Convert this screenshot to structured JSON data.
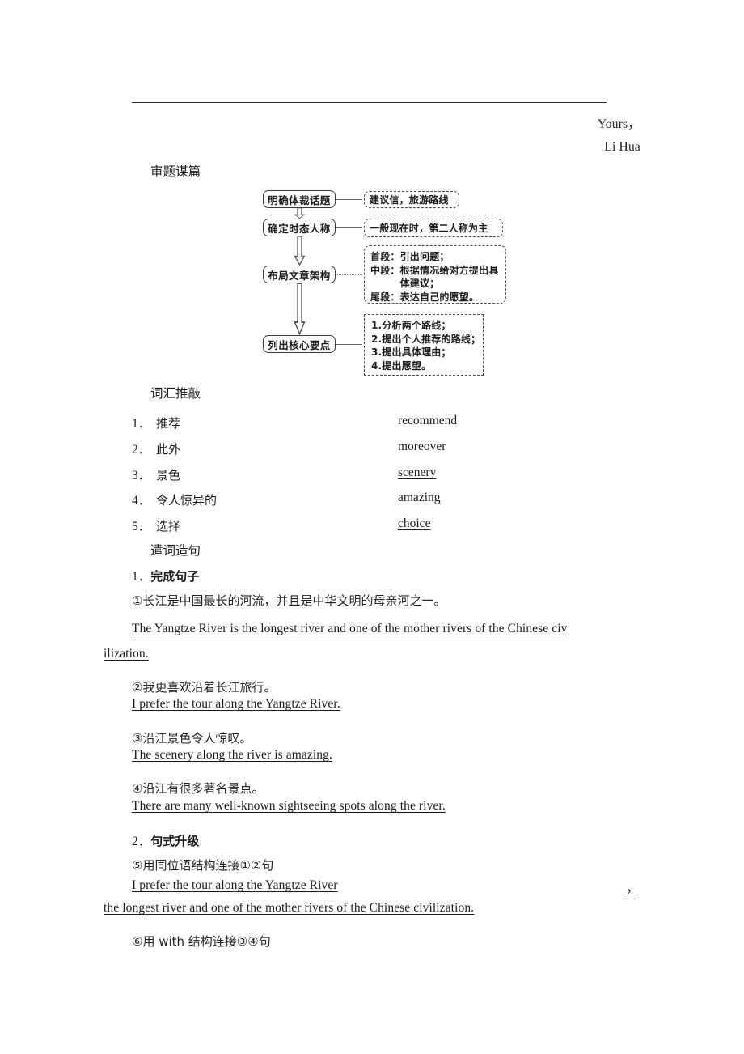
{
  "signature": {
    "closing": "Yours，",
    "name": "Li Hua"
  },
  "sections": {
    "analysis_label": "审题谋篇",
    "vocab_label": "词汇推敲",
    "sentence_label": "遣词造句"
  },
  "flowchart": {
    "nodes": [
      {
        "label": "明确体裁话题"
      },
      {
        "label": "确定时态人称"
      },
      {
        "label": "布局文章架构"
      },
      {
        "label": "列出核心要点"
      }
    ],
    "callouts": [
      {
        "lines": [
          "建议信，旅游路线"
        ]
      },
      {
        "lines": [
          "一般现在时，第二人称为主"
        ]
      },
      {
        "rows": [
          {
            "tag": "首段：",
            "body": "引出问题；"
          },
          {
            "tag": "中段：",
            "body": "根据情况给对方提出具体建议；"
          },
          {
            "tag": "尾段：",
            "body": "表达自己的愿望。"
          }
        ]
      },
      {
        "rows": [
          {
            "body": "1.分析两个路线；"
          },
          {
            "body": "2.提出个人推荐的路线；"
          },
          {
            "body": "3.提出具体理由；"
          },
          {
            "body": "4.提出愿望。"
          }
        ]
      }
    ]
  },
  "vocabulary": [
    {
      "num": "1．",
      "cn": "推荐",
      "answer": "recommend"
    },
    {
      "num": "2．",
      "cn": "此外",
      "answer": "moreover"
    },
    {
      "num": "3．",
      "cn": "景色",
      "answer": "scenery"
    },
    {
      "num": "4．",
      "cn": "令人惊异的",
      "answer": "amazing"
    },
    {
      "num": "5．",
      "cn": "选择",
      "answer": "choice"
    }
  ],
  "exercises": {
    "head1_num": "1．",
    "head1_text": "完成句子",
    "head2_num": "2．",
    "head2_text": "句式升级",
    "q1_prompt": "①长江是中国最长的河流，并且是中华文明的母亲河之一。",
    "q1_answer_line1": "The  Yangtze  River  is  the  longest  river  and  one  of  the  mother  rivers  of  the  Chinese  civ",
    "q1_answer_line2": "ilization.  ",
    "q2_prompt": "②我更喜欢沿着长江旅行。",
    "q2_answer": "I  prefer  the  tour  along  the  Yangtze  River.  ",
    "q3_prompt": "③沿江景色令人惊叹。",
    "q3_answer": "The  scenery  along  the  river  is  amazing.  ",
    "q4_prompt": "④沿江有很多著名景点。",
    "q4_answer": "There  are  many  well-known  sightseeing  spots  along  the  river.  ",
    "q5_prompt": "⑤用同位语结构连接①②句",
    "q5_answer_line1_start": "I  prefer  the  tour  along  the  Yangtze  River",
    "q5_answer_line1_end": "，",
    "q5_answer_line2": "the  longest  river  and  one  of  the  mother  rivers  of  the  Chinese  civilization.  ",
    "q6_prompt": "⑥用 with 结构连接③④句"
  }
}
